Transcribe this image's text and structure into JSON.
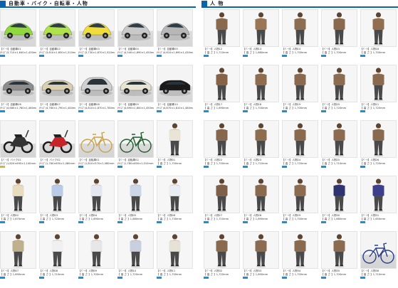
{
  "vehicles": {
    "title": "自動車・バイク・自転車・人物",
    "items": [
      {
        "kind": "car",
        "color": "#8fd93a",
        "name": "【ﾊﾟｰﾂ】自動車01",
        "dims": "(ｻｲｽﾞ)3,710×1,640×1,430mm"
      },
      {
        "kind": "car",
        "color": "#aee34a",
        "name": "【ﾊﾟｰﾂ】自動車02",
        "dims": "(ｻｲｽﾞ)3,610×1,650×1,510mm"
      },
      {
        "kind": "car",
        "color": "#f0dc3a",
        "name": "【ﾊﾟｰﾂ】自動車03",
        "dims": "(ｻｲｽﾞ)3,730×1,670×1,520mm"
      },
      {
        "kind": "car",
        "color": "#c9c9c9",
        "name": "【ﾊﾟｰﾂ】自動車04",
        "dims": "(ｻｲｽﾞ)4,540×1,690×1,450mm"
      },
      {
        "kind": "car",
        "color": "#b7b7b7",
        "name": "【ﾊﾟｰﾂ】自動車05",
        "dims": "(ｻｲｽﾞ)4,610×1,690×1,430mm"
      },
      {
        "kind": "sedan",
        "color": "#8d8d8d",
        "name": "【ﾊﾟｰﾂ】自動車06",
        "dims": "(ｻｲｽﾞ)4,680×1,760×1,460mm"
      },
      {
        "kind": "sedan",
        "color": "#d8d0b0",
        "name": "【ﾊﾟｰﾂ】自動車07",
        "dims": "(ｻｲｽﾞ)4,760×1,790×1,440mm"
      },
      {
        "kind": "suv",
        "color": "#d0d0d0",
        "name": "【ﾊﾟｰﾂ】自動車08",
        "dims": "(ｻｲｽﾞ)4,810×1,870×1,780mm"
      },
      {
        "kind": "sedan",
        "color": "#e8e4d2",
        "name": "【ﾊﾟｰﾂ】自動車09",
        "dims": "(ｻｲｽﾞ)4,690×1,800×1,450mm"
      },
      {
        "kind": "sedan",
        "color": "#1a1a1a",
        "name": "【ﾊﾟｰﾂ】自動車10",
        "dims": "(ｻｲｽﾞ)4,870×1,810×1,480mm"
      },
      {
        "kind": "moto",
        "color": "#333333",
        "name": "【ﾊﾟｰﾂ】バイク01",
        "dims": "(ｻｲｽﾞ)1,820×690×1,140mm"
      },
      {
        "kind": "moto",
        "color": "#c7242a",
        "name": "【ﾊﾟｰﾂ】バイク02",
        "dims": "(ｻｲｽﾞ)1,760×650×1,080mm"
      },
      {
        "kind": "bicycle",
        "color": "#c9a24a",
        "name": "【ﾊﾟｰﾂ】自転車01",
        "dims": "(ｻｲｽﾞ)1,810×570×1,080mm"
      },
      {
        "kind": "bicycle",
        "color": "#1f5c2e",
        "name": "【ﾊﾟｰﾂ】自転車02",
        "dims": "(ｻｲｽﾞ)1,780×600×1,010mm"
      },
      {
        "kind": "person",
        "color": "#e9e4d6",
        "name": "【ﾊﾟｰﾂ】人物01",
        "dims": "【 高 さ 】1,750mm"
      },
      {
        "kind": "person",
        "color": "#e8dcc0",
        "name": "【ﾊﾟｰﾂ】人物02",
        "dims": "【 高 さ 】1,670mm"
      },
      {
        "kind": "person",
        "color": "#b9cbe6",
        "name": "【ﾊﾟｰﾂ】人物03",
        "dims": "【 高 さ 】1,720mm"
      },
      {
        "kind": "person",
        "color": "#e4e7ef",
        "name": "【ﾊﾟｰﾂ】人物04",
        "dims": "【 高 さ 】1,690mm"
      },
      {
        "kind": "person",
        "color": "#cdd6e6",
        "name": "【ﾊﾟｰﾂ】人物05",
        "dims": "【 高 さ 】1,680mm"
      },
      {
        "kind": "person",
        "color": "#e9ecf2",
        "name": "【ﾊﾟｰﾂ】人物06",
        "dims": "【 高 さ 】1,730mm"
      },
      {
        "kind": "person",
        "color": "#bfb08e",
        "name": "【ﾊﾟｰﾂ】人物07",
        "dims": "【 高 さ 】1,690mm"
      },
      {
        "kind": "person",
        "color": "#f0f0f0",
        "name": "【ﾊﾟｰﾂ】人物08",
        "dims": "【 高 さ 】1,710mm"
      },
      {
        "kind": "person",
        "color": "#e7e7e7",
        "name": "【ﾊﾟｰﾂ】人物09",
        "dims": "【 高 さ 】1,700mm"
      },
      {
        "kind": "person",
        "color": "#c8d0e0",
        "name": "【ﾊﾟｰﾂ】人物10",
        "dims": "【 高 さ 】1,720mm"
      },
      {
        "kind": "person",
        "color": "#e7e2d6",
        "name": "【ﾊﾟｰﾂ】人物11",
        "dims": "【 高 さ 】1,700mm"
      }
    ]
  },
  "people": {
    "title": "人 物",
    "items": [
      {
        "kind": "person",
        "color": "#8a6a4e",
        "name": "【ﾊﾟｰﾂ】人物12",
        "dims": "【 高 さ 】1,710mm"
      },
      {
        "kind": "person",
        "color": "#9a7556",
        "name": "【ﾊﾟｰﾂ】人物13",
        "dims": "【 高 さ 】1,680mm"
      },
      {
        "kind": "person",
        "color": "#8c6d52",
        "name": "【ﾊﾟｰﾂ】人物14",
        "dims": "【 高 さ 】1,700mm"
      },
      {
        "kind": "person",
        "color": "#8a6a4e",
        "name": "【ﾊﾟｰﾂ】人物15",
        "dims": "【 高 さ 】1,700mm"
      },
      {
        "kind": "person",
        "color": "#916e50",
        "name": "【ﾊﾟｰﾂ】人物16",
        "dims": "【 高 さ 】1,700mm"
      },
      {
        "kind": "person",
        "color": "#866247",
        "name": "【ﾊﾟｰﾂ】人物17",
        "dims": "【 高 さ 】1,690mm"
      },
      {
        "kind": "person",
        "color": "#8e6c50",
        "name": "【ﾊﾟｰﾂ】人物18",
        "dims": "【 高 さ 】1,700mm"
      },
      {
        "kind": "person",
        "color": "#8a6a4e",
        "name": "【ﾊﾟｰﾂ】人物19",
        "dims": "【 高 さ 】1,700mm"
      },
      {
        "kind": "person",
        "color": "#8c6c50",
        "name": "【ﾊﾟｰﾂ】人物20",
        "dims": "【 高 さ 】1,720mm"
      },
      {
        "kind": "person",
        "color": "#8a6a4e",
        "name": "【ﾊﾟｰﾂ】人物21",
        "dims": "【 高 さ 】1,720mm"
      },
      {
        "kind": "person",
        "color": "#86664c",
        "name": "【ﾊﾟｰﾂ】人物22",
        "dims": "【 高 さ 】1,700mm"
      },
      {
        "kind": "person",
        "color": "#8e6c50",
        "name": "【ﾊﾟｰﾂ】人物23",
        "dims": "【 高 さ 】1,710mm"
      },
      {
        "kind": "person",
        "color": "#8a6a4e",
        "name": "【ﾊﾟｰﾂ】人物24",
        "dims": "【 高 さ 】1,720mm"
      },
      {
        "kind": "person",
        "color": "#8c6c50",
        "name": "【ﾊﾟｰﾂ】人物25",
        "dims": "【 高 さ 】1,710mm"
      },
      {
        "kind": "person",
        "color": "#8a6a4e",
        "name": "【ﾊﾟｰﾂ】人物26",
        "dims": "【 高 さ 】1,720mm"
      },
      {
        "kind": "person",
        "color": "#7e6048",
        "name": "【ﾊﾟｰﾂ】人物27",
        "dims": "【 高 さ 】1,710mm"
      },
      {
        "kind": "person",
        "color": "#8a6a4e",
        "name": "【ﾊﾟｰﾂ】人物28",
        "dims": "【 高 さ 】1,690mm"
      },
      {
        "kind": "person",
        "color": "#8c6c50",
        "name": "【ﾊﾟｰﾂ】人物29",
        "dims": "【 高 さ 】1,700mm"
      },
      {
        "kind": "person",
        "color": "#2e3470",
        "name": "【ﾊﾟｰﾂ】人物30",
        "dims": "【 高 さ 】1,680mm"
      },
      {
        "kind": "person",
        "color": "#3b3f8c",
        "name": "【ﾊﾟｰﾂ】人物31",
        "dims": "【 高 さ 】1,650mm"
      },
      {
        "kind": "person",
        "color": "#8a6a4e",
        "name": "【ﾊﾟｰﾂ】人物32",
        "dims": "【 高 さ 】1,720mm"
      },
      {
        "kind": "person",
        "color": "#8c6c50",
        "name": "【ﾊﾟｰﾂ】人物33",
        "dims": "【 高 さ 】1,690mm"
      },
      {
        "kind": "person",
        "color": "#8a6a4e",
        "name": "【ﾊﾟｰﾂ】人物34",
        "dims": "【 高 さ 】1,700mm"
      },
      {
        "kind": "person",
        "color": "#8c6c50",
        "name": "【ﾊﾟｰﾂ】人物35",
        "dims": "【 高 さ 】1,700mm"
      },
      {
        "kind": "bicycle",
        "color": "#2a3e8c",
        "name": "【ﾊﾟｰﾂ】人物36",
        "dims": "【 高 さ 】1,710mm"
      }
    ]
  }
}
